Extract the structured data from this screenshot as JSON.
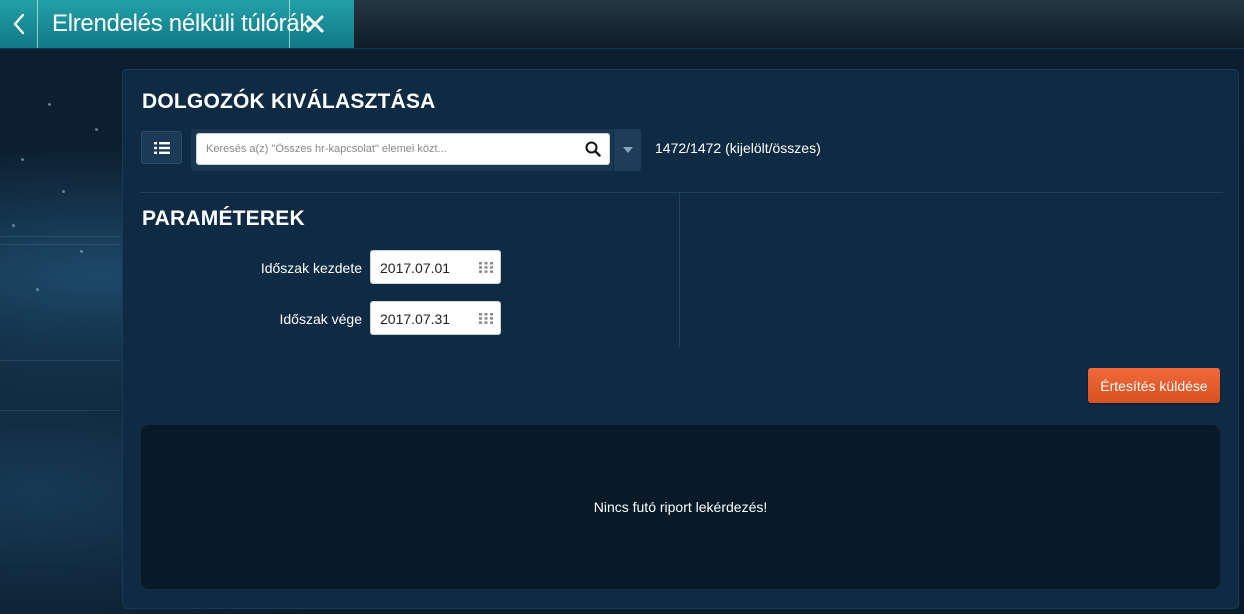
{
  "tab": {
    "title": "Elrendelés nélküli túlórák"
  },
  "employees": {
    "section_title": "DOLGOZÓK KIVÁLASZTÁSA",
    "search_placeholder": "Keresés a(z) \"Összes hr-kapcsolat\" elemei közt...",
    "count_text": "1472/1472 (kijelölt/összes)"
  },
  "parameters": {
    "section_title": "PARAMÉTEREK",
    "start_label": "Időszak kezdete",
    "start_value": "2017.07.01",
    "end_label": "Időszak vége",
    "end_value": "2017.07.31"
  },
  "actions": {
    "send_label": "Értesítés küldése"
  },
  "report": {
    "empty_text": "Nincs futó riport lekérdezés!"
  },
  "icons": {
    "back": "chevron-left-icon",
    "close": "close-icon",
    "list": "list-icon",
    "search": "search-icon",
    "dropdown": "caret-down-icon",
    "calendar": "calendar-grid-icon"
  },
  "colors": {
    "tab_teal": "#1a8f99",
    "panel_bg": "#0f2b44",
    "report_bg": "#081a28",
    "accent_orange": "#e45a28"
  }
}
